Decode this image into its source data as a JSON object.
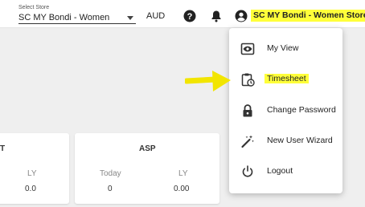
{
  "header": {
    "store_caption": "Select Store",
    "store_value": "SC MY Bondi - Women",
    "currency": "AUD",
    "user_name": "SC MY Bondi - Women Store"
  },
  "cards": {
    "left": {
      "title_fragment": "T",
      "ly_label": "LY",
      "ly_value": "0.0"
    },
    "asp": {
      "title": "ASP",
      "today_label": "Today",
      "today_value": "0",
      "ly_label": "LY",
      "ly_value": "0.00"
    }
  },
  "menu": {
    "items": [
      {
        "label": "My View",
        "icon": "eye-icon"
      },
      {
        "label": "Timesheet",
        "icon": "clipboard-clock-icon"
      },
      {
        "label": "Change Password",
        "icon": "lock-icon"
      },
      {
        "label": "New User Wizard",
        "icon": "magic-wand-icon"
      },
      {
        "label": "Logout",
        "icon": "power-icon"
      }
    ]
  },
  "colors": {
    "highlight": "#ffff3a",
    "icon": "#333333",
    "arrow": "#f2e500"
  }
}
